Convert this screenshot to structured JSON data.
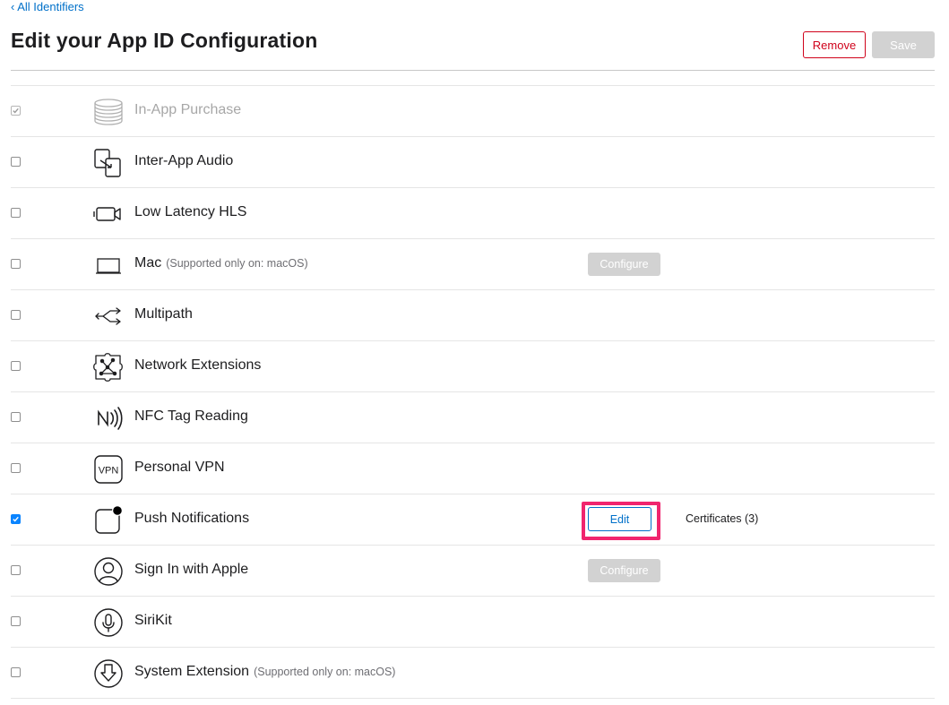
{
  "nav": {
    "back_label": "‹ All Identifiers"
  },
  "header": {
    "title": "Edit your App ID Configuration",
    "remove_label": "Remove",
    "save_label": "Save"
  },
  "capabilities": [
    {
      "name": "In-App Purchase",
      "checked": true,
      "disabled": true,
      "icon": "coins-icon"
    },
    {
      "name": "Inter-App Audio",
      "checked": false,
      "icon": "inter-app-audio-icon"
    },
    {
      "name": "Low Latency HLS",
      "checked": false,
      "icon": "video-camera-icon"
    },
    {
      "name": "Mac",
      "note": "(Supported only on: macOS)",
      "checked": false,
      "icon": "laptop-icon",
      "button": "Configure"
    },
    {
      "name": "Multipath",
      "checked": false,
      "icon": "multipath-arrows-icon"
    },
    {
      "name": "Network Extensions",
      "checked": false,
      "icon": "network-extensions-icon"
    },
    {
      "name": "NFC Tag Reading",
      "checked": false,
      "icon": "nfc-icon"
    },
    {
      "name": "Personal VPN",
      "checked": false,
      "icon": "vpn-icon",
      "icon_text": "VPN"
    },
    {
      "name": "Push Notifications",
      "checked": true,
      "icon": "push-notification-icon",
      "edit_label": "Edit",
      "certificates": "Certificates (3)"
    },
    {
      "name": "Sign In with Apple",
      "checked": false,
      "icon": "person-icon",
      "button": "Configure"
    },
    {
      "name": "SiriKit",
      "checked": false,
      "icon": "microphone-icon"
    },
    {
      "name": "System Extension",
      "note": "(Supported only on: macOS)",
      "checked": false,
      "icon": "system-extension-icon"
    }
  ],
  "colors": {
    "link": "#0070c9",
    "remove": "#d0021b",
    "checkbox_checked": "#0a84ff",
    "highlight": "#f0256e",
    "disabled_button": "#d2d2d2"
  }
}
